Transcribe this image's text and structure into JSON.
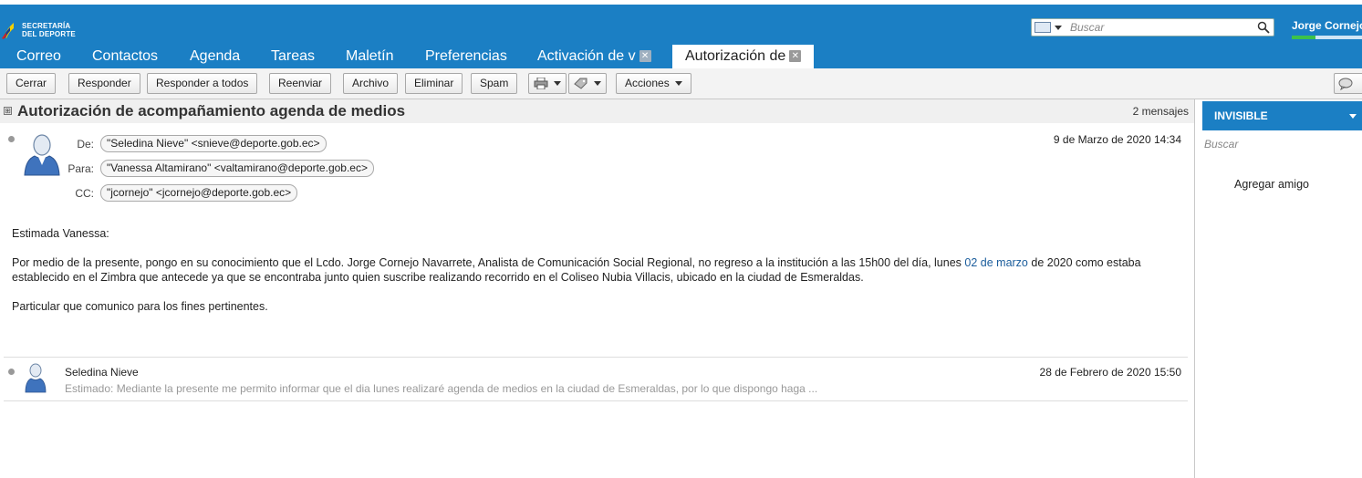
{
  "app": {
    "logo_line1": "SECRETARÍA",
    "logo_line2": "DEL DEPORTE",
    "search_placeholder": "Buscar",
    "user_name": "Jorge Cornejo",
    "quota_fraction": 0.34
  },
  "tabs": [
    {
      "label": "Correo"
    },
    {
      "label": "Contactos"
    },
    {
      "label": "Agenda"
    },
    {
      "label": "Tareas"
    },
    {
      "label": "Maletín"
    },
    {
      "label": "Preferencias"
    },
    {
      "label": "Activación de v"
    },
    {
      "label": "Autorización de"
    }
  ],
  "toolbar": {
    "close": "Cerrar",
    "reply": "Responder",
    "reply_all": "Responder a todos",
    "forward": "Reenviar",
    "archive": "Archivo",
    "delete": "Eliminar",
    "spam": "Spam",
    "actions": "Acciones"
  },
  "conversation": {
    "subject": "Autorización de acompañamiento agenda de medios",
    "count": "2 mensajes"
  },
  "message1": {
    "from_label": "De:",
    "from": "\"Seledina Nieve\" <snieve@deporte.gob.ec>",
    "to_label": "Para:",
    "to": "\"Vanessa Altamirano\" <valtamirano@deporte.gob.ec>",
    "cc_label": "CC:",
    "cc": "\"jcornejo\" <jcornejo@deporte.gob.ec>",
    "date": "9 de Marzo de 2020 14:34",
    "greeting": "Estimada Vanessa:",
    "para1_a": "Por medio de la presente, pongo en su conocimiento que el Lcdo. Jorge Cornejo Navarrete, Analista de Comunicación Social Regional, no regreso a la institución a las 15h00 del día, lunes ",
    "para1_link": "02 de marzo",
    "para1_b": " de 2020 como estaba establecido en el Zimbra que antecede ya que se encontraba junto quien suscribe realizando recorrido en el Coliseo Nubia Villacis, ubicado en la ciudad de Esmeraldas.",
    "para2": "Particular que comunico para los fines pertinentes."
  },
  "message2": {
    "sender": "Seledina Nieve",
    "date": "28 de Febrero de 2020 15:50",
    "fragment": "Estimado: Mediante la presente me permito informar que el dia lunes realizaré agenda de medios en la ciudad de Esmeraldas, por lo que dispongo haga ..."
  },
  "sidebar": {
    "status": "INVISIBLE",
    "search_placeholder": "Buscar",
    "add_friend": "Agregar amigo"
  }
}
